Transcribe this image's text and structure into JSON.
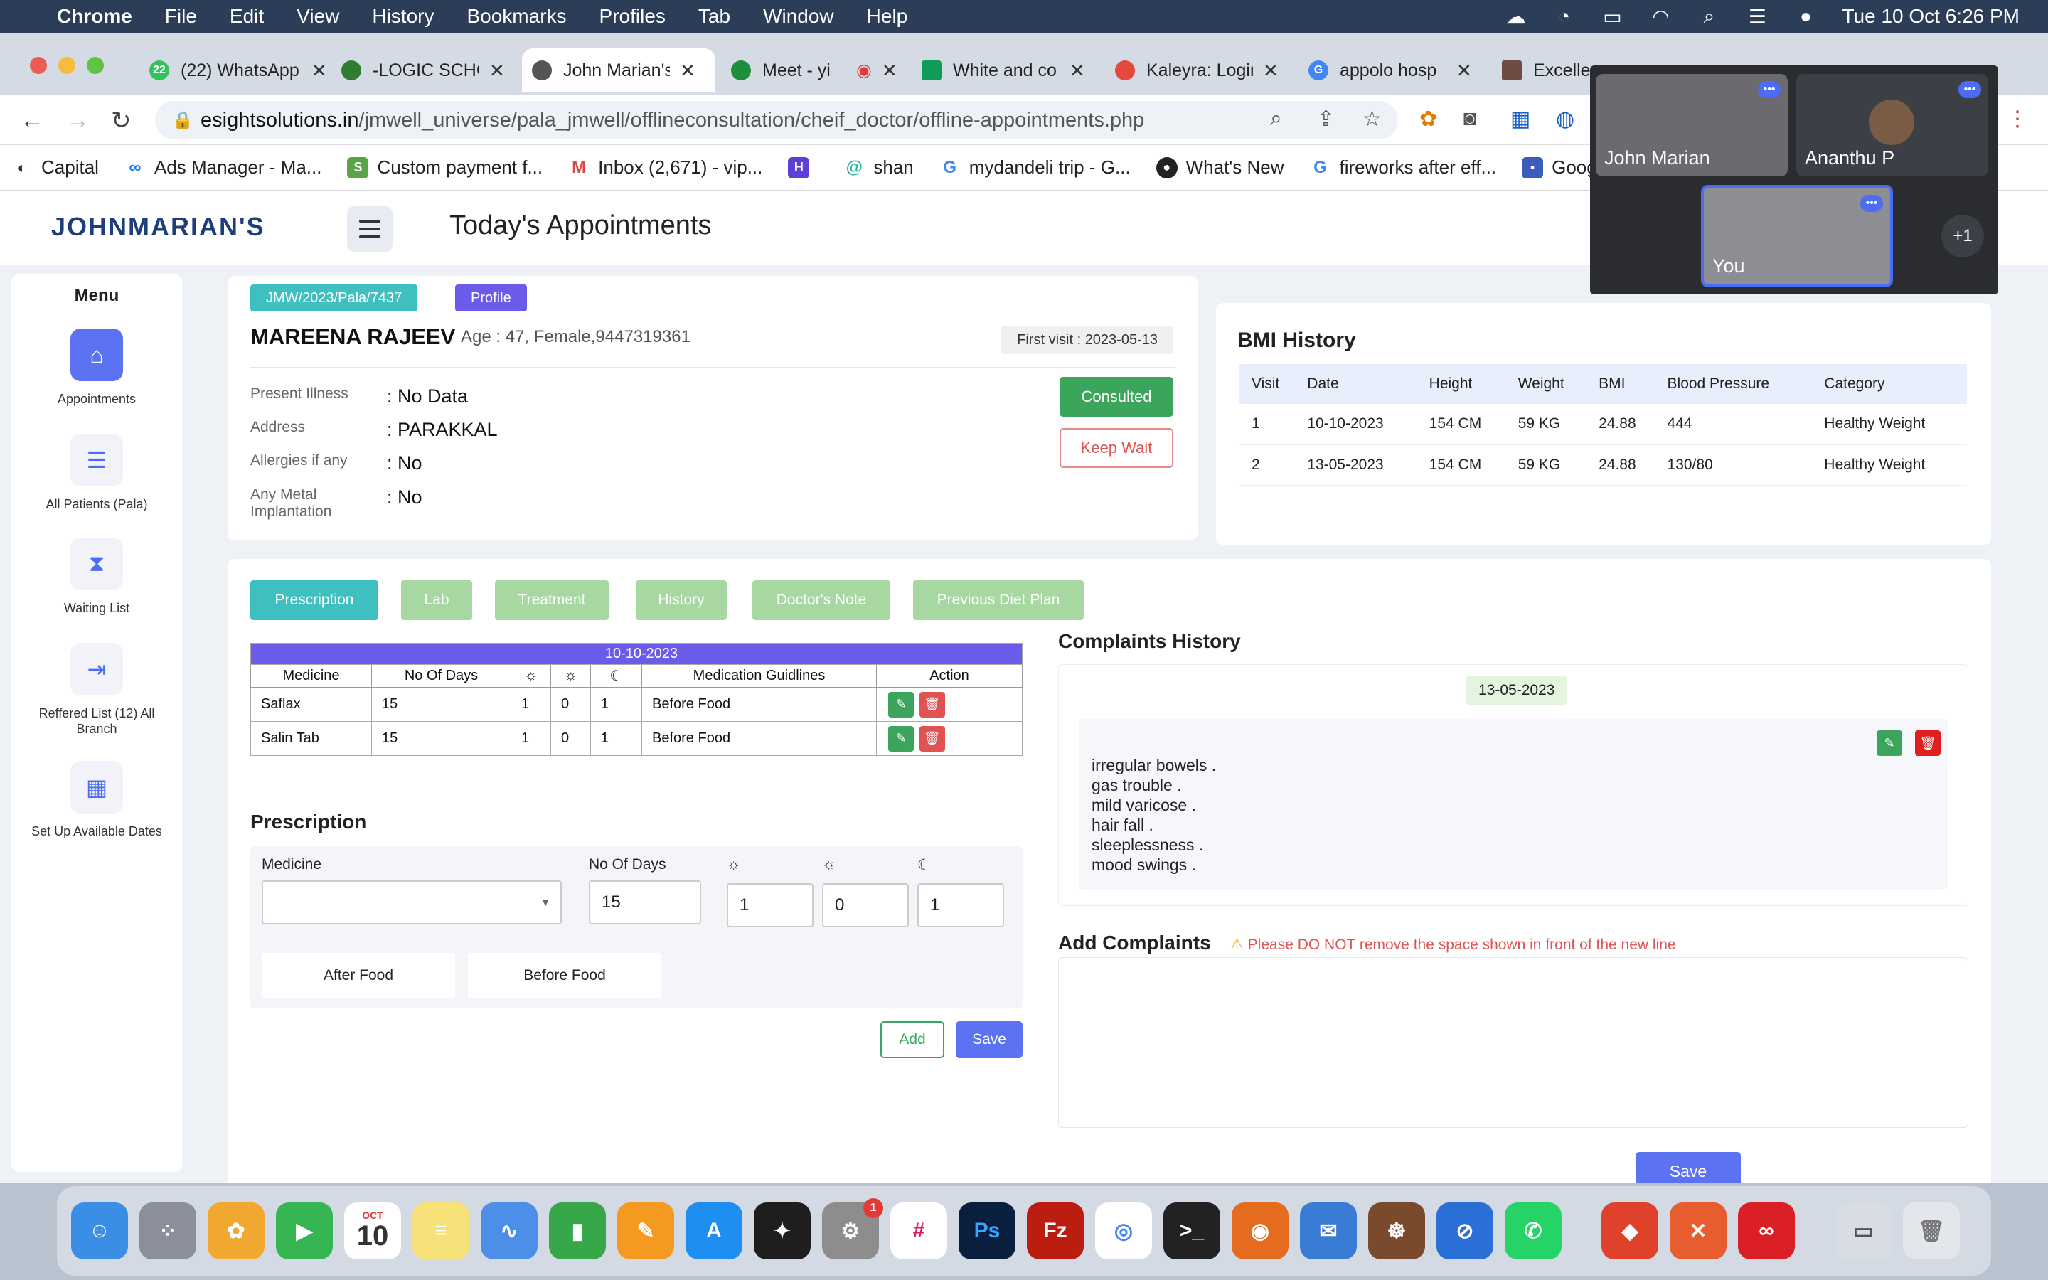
{
  "menubar": {
    "app": "Chrome",
    "items": [
      "File",
      "Edit",
      "View",
      "History",
      "Bookmarks",
      "Profiles",
      "Tab",
      "Window",
      "Help"
    ],
    "datetime": "Tue 10 Oct  6:26 PM"
  },
  "tabs": [
    {
      "label": "(22) WhatsApp",
      "badge": "22"
    },
    {
      "label": "-LOGIC SCHOOL"
    },
    {
      "label": "John Marian's"
    },
    {
      "label": "Meet - yi"
    },
    {
      "label": "White and co"
    },
    {
      "label": "Kaleyra: Login"
    },
    {
      "label": "appolo hosp"
    },
    {
      "label": "Excelle..."
    }
  ],
  "address": {
    "host": "esightsolutions.in",
    "path": "/jmwell_universe/pala_jmwell/offlineconsultation/cheif_doctor/offline-appointments.php"
  },
  "bookmarks": [
    "Capital",
    "Ads Manager - Ma...",
    "Custom payment f...",
    "Inbox (2,671) - vip...",
    "",
    "shan",
    "mydandeli trip - G...",
    "What's New",
    "fireworks after eff...",
    "Goog"
  ],
  "app": {
    "logo": "JOHNMARIAN'S",
    "page_title": "Today's Appointments"
  },
  "sidebar": {
    "title": "Menu",
    "items": [
      {
        "label": "Appointments",
        "icon": "home-icon"
      },
      {
        "label": "All Patients (Pala)",
        "icon": "list-icon"
      },
      {
        "label": "Waiting List",
        "icon": "hourglass-icon"
      },
      {
        "label": "Reffered List (12) All Branch",
        "icon": "sign-in-icon"
      },
      {
        "label": "Set Up Available Dates",
        "icon": "calendar-icon"
      }
    ]
  },
  "patient": {
    "id": "JMW/2023/Pala/7437",
    "profile_label": "Profile",
    "name": "MAREENA RAJEEV",
    "info": "Age : 47, Female,9447319361",
    "first_visit": "First visit : 2023-05-13",
    "fields": [
      {
        "label": "Present Illness",
        "value": ": No Data"
      },
      {
        "label": "Address",
        "value": ": PARAKKAL"
      },
      {
        "label": "Allergies if any",
        "value": ": No"
      },
      {
        "label": "Any Metal Implantation",
        "value": ": No"
      }
    ],
    "consulted_label": "Consulted",
    "keepwait_label": "Keep Wait"
  },
  "bmi": {
    "title": "BMI History",
    "headers": [
      "Visit",
      "Date",
      "Height",
      "Weight",
      "BMI",
      "Blood Pressure",
      "Category"
    ],
    "rows": [
      [
        "1",
        "10-10-2023",
        "154 CM",
        "59 KG",
        "24.88",
        "444",
        "Healthy Weight"
      ],
      [
        "2",
        "13-05-2023",
        "154 CM",
        "59 KG",
        "24.88",
        "130/80",
        "Healthy Weight"
      ]
    ]
  },
  "panel_tabs": [
    "Prescription",
    "Lab",
    "Treatment",
    "History",
    "Doctor's Note",
    "Previous Diet Plan"
  ],
  "rx_table": {
    "date": "10-10-2023",
    "headers": [
      "Medicine",
      "No Of Days",
      "",
      "",
      "",
      "Medication Guidlines",
      "Action"
    ],
    "rows": [
      [
        "Saflax",
        "15",
        "1",
        "0",
        "1",
        "Before Food"
      ],
      [
        "Salin Tab",
        "15",
        "1",
        "0",
        "1",
        "Before Food"
      ]
    ]
  },
  "rx_form": {
    "title": "Prescription",
    "medicine_label": "Medicine",
    "days_label": "No Of Days",
    "days_value": "15",
    "morning": "1",
    "noon": "0",
    "night": "1",
    "after_food": "After Food",
    "before_food": "Before Food",
    "add_label": "Add",
    "save_label": "Save"
  },
  "complaints": {
    "title": "Complaints History",
    "date": "13-05-2023",
    "lines": [
      "irregular bowels .",
      "gas trouble .",
      "mild varicose .",
      "hair fall .",
      "sleeplessness .",
      "mood swings ."
    ]
  },
  "add_complaints": {
    "title": "Add Complaints",
    "warning": "Please DO NOT remove the space shown in front of the new line",
    "save_label": "Save"
  },
  "meet": {
    "participants": [
      "John Marian",
      "Ananthu P",
      "You"
    ],
    "extra": "+1"
  },
  "dock": {
    "calendar_month": "OCT",
    "calendar_day": "10",
    "notification": "1"
  }
}
